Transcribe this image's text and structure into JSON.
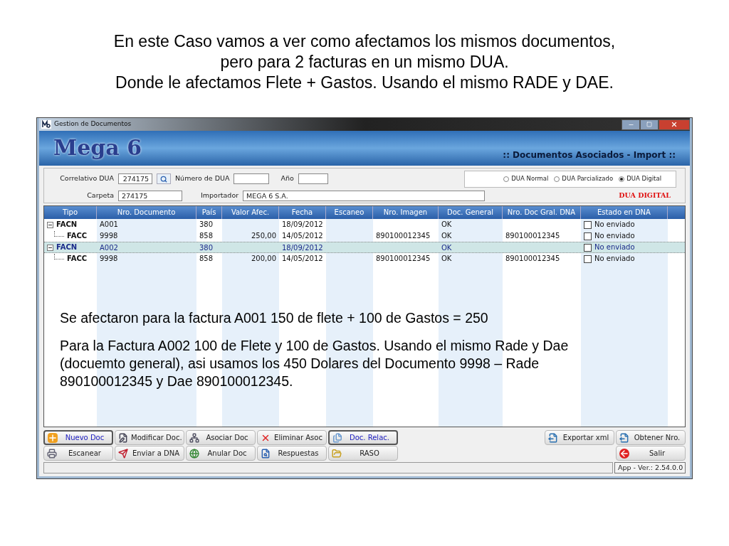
{
  "slide_title": [
    "En este Caso vamos a ver como afectamos los mismos documentos,",
    "pero para 2 facturas en un mismo DUA.",
    "Donde le afectamos Flete + Gastos. Usando el mismo RADE y DAE."
  ],
  "window": {
    "title": "Gestion de Documentos",
    "logo": "Mega 6",
    "module_title": ":: Documentos Asociados - Import ::"
  },
  "form": {
    "correlativo_label": "Correlativo DUA",
    "correlativo_value": "274175",
    "numero_label": "Número de  DUA",
    "anio_label": "Año",
    "carpeta_label": "Carpeta",
    "carpeta_value": "274175",
    "importador_label": "Importador",
    "importador_value": "MEGA 6 S.A.",
    "dua_types": [
      {
        "label": "DUA Normal",
        "selected": false
      },
      {
        "label": "DUA Parcializado",
        "selected": false
      },
      {
        "label": "DUA Digital",
        "selected": true
      }
    ],
    "dua_status": "DUA DIGITAL"
  },
  "table": {
    "columns": [
      "Tipo",
      "Nro. Documento",
      "País",
      "Valor Afec.",
      "Fecha",
      "Escaneo",
      "Nro. Imagen",
      "Doc. General",
      "Nro. Doc Gral. DNA",
      "Estado en DNA"
    ],
    "rows": [
      {
        "tipo": "FACN",
        "documento": "A001",
        "pais": "380",
        "valor": "",
        "fecha": "18/09/2012",
        "imagen": "",
        "doc_general": "OK",
        "nro_gral": "",
        "estado": "No enviado",
        "checked": false,
        "selected": false,
        "expanded": true,
        "children": [
          {
            "tipo": "FACC",
            "documento": "9998",
            "pais": "858",
            "valor": "250,00",
            "fecha": "14/05/2012",
            "imagen": "890100012345",
            "doc_general": "OK",
            "nro_gral": "890100012345",
            "estado": "No enviado",
            "checked": false,
            "selected": false
          }
        ]
      },
      {
        "tipo": "FACN",
        "documento": "A002",
        "pais": "380",
        "valor": "",
        "fecha": "18/09/2012",
        "imagen": "",
        "doc_general": "OK",
        "nro_gral": "",
        "estado": "No enviado",
        "checked": false,
        "selected": true,
        "expanded": true,
        "children": [
          {
            "tipo": "FACC",
            "documento": "9998",
            "pais": "858",
            "valor": "200,00",
            "fecha": "14/05/2012",
            "imagen": "890100012345",
            "doc_general": "OK",
            "nro_gral": "890100012345",
            "estado": "No enviado",
            "checked": false,
            "selected": false
          }
        ]
      }
    ]
  },
  "annotation": [
    "Se afectaron para la factura A001 150 de flete + 100 de Gastos = 250",
    "Para la Factura A002 100 de Flete y 100 de Gastos.  Usando el mismo Rade y Dae (docuemto general), asi usamos los 450 Dolares del Documento 9998 – Rade 890100012345 y Dae 890100012345."
  ],
  "buttons_left": [
    [
      {
        "label": "Nuevo Doc",
        "kind": "plus",
        "focused": true
      },
      {
        "label": "Modificar Doc.",
        "kind": "edit",
        "focused": false
      },
      {
        "label": "Asociar Doc",
        "kind": "tree",
        "focused": false
      },
      {
        "label": "Eliminar Asoc",
        "kind": "cross",
        "focused": false
      },
      {
        "label": "Doc. Relac.",
        "kind": "docs",
        "focused": true
      }
    ],
    [
      {
        "label": "Escanear",
        "kind": "scanner",
        "focused": false
      },
      {
        "label": "Enviar a DNA",
        "kind": "send",
        "focused": false
      },
      {
        "label": "Anular Doc",
        "kind": "globe",
        "focused": false
      },
      {
        "label": "Respuestas",
        "kind": "search",
        "focused": false
      },
      {
        "label": "RASO",
        "kind": "folder",
        "focused": false
      }
    ]
  ],
  "buttons_right": [
    [
      {
        "label": "Exportar xml",
        "kind": "export",
        "focused": false
      },
      {
        "label": "Obtener Nro.",
        "kind": "export",
        "focused": false
      }
    ],
    [
      {
        "label": "Salir",
        "kind": "exit",
        "focused": false
      }
    ]
  ],
  "status_bar": {
    "version": "App - Ver.: 2.54.0.0"
  }
}
